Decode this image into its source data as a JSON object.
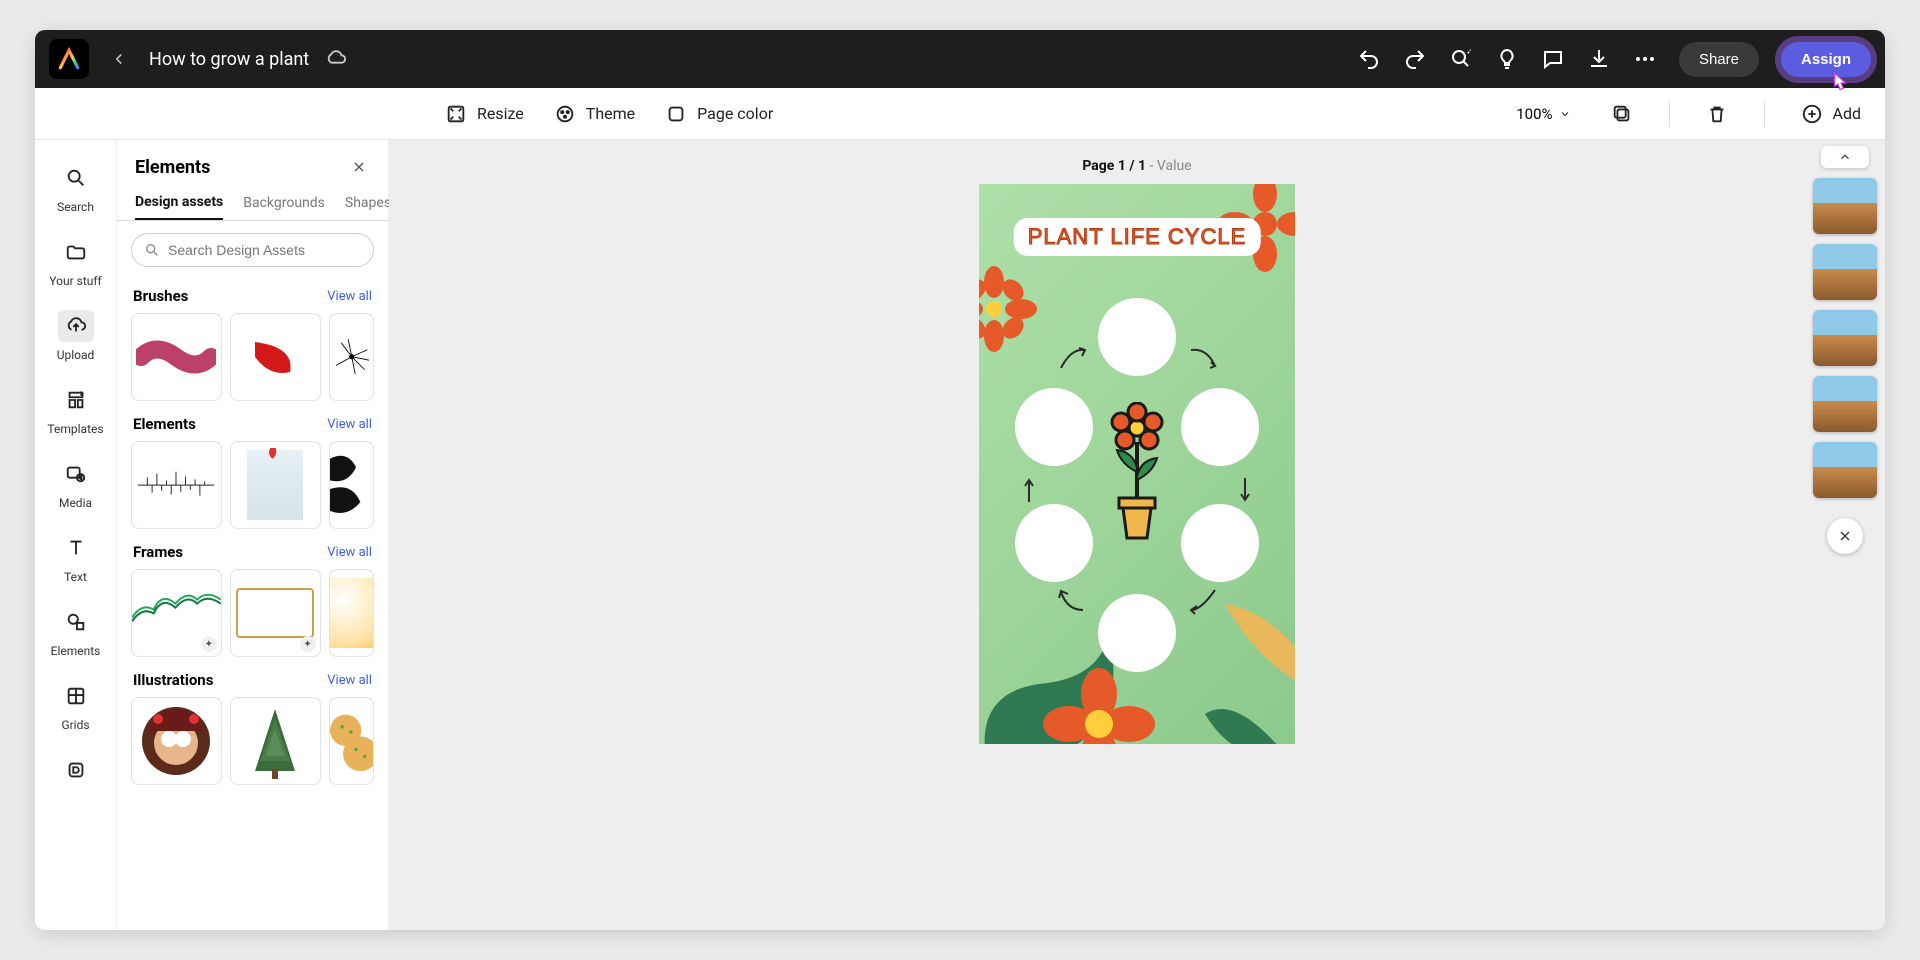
{
  "header": {
    "doc_title": "How to grow a plant",
    "share_label": "Share",
    "assign_label": "Assign"
  },
  "contextbar": {
    "resize": "Resize",
    "theme": "Theme",
    "page_color": "Page color",
    "zoom": "100%",
    "add": "Add"
  },
  "rail": {
    "items": [
      {
        "label": "Search"
      },
      {
        "label": "Your stuff"
      },
      {
        "label": "Upload"
      },
      {
        "label": "Templates"
      },
      {
        "label": "Media"
      },
      {
        "label": "Text"
      },
      {
        "label": "Elements"
      },
      {
        "label": "Grids"
      }
    ]
  },
  "panel": {
    "title": "Elements",
    "tabs": [
      "Design assets",
      "Backgrounds",
      "Shapes"
    ],
    "active_tab": 0,
    "search_placeholder": "Search Design Assets",
    "view_all_label": "View all",
    "sections": [
      {
        "title": "Brushes"
      },
      {
        "title": "Elements"
      },
      {
        "title": "Frames"
      },
      {
        "title": "Illustrations"
      }
    ]
  },
  "canvas": {
    "page_label_prefix": "Page ",
    "page_current": "1",
    "page_sep": " / ",
    "page_total": "1",
    "page_dash": " - ",
    "page_value": "Value",
    "artboard_title": "PLANT LIFE CYCLE"
  },
  "thumbnails": {
    "count": 5
  }
}
